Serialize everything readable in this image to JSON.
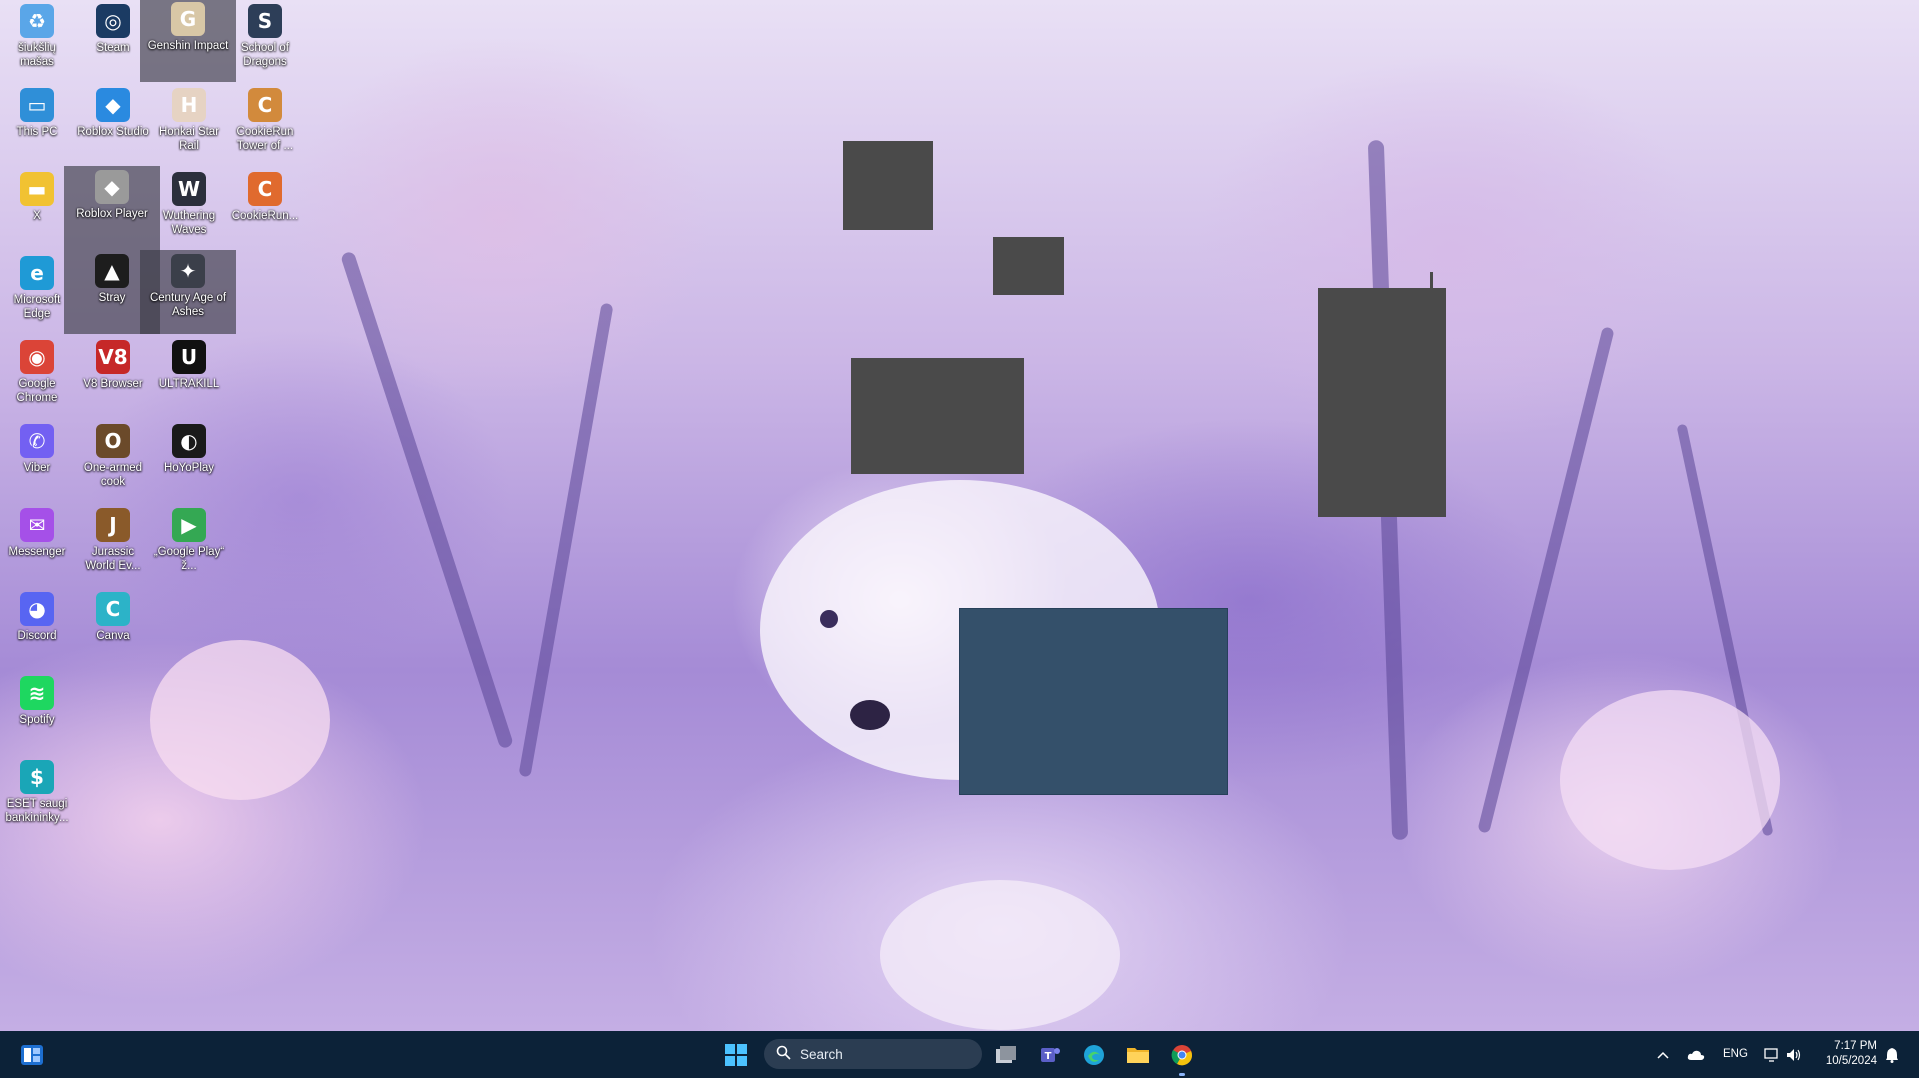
{
  "desktop": {
    "icons": [
      {
        "label": "šiukšlių mašas",
        "icon": "recycle-bin-icon",
        "glyph": "♻",
        "color": "#5aa6e8",
        "selected": false
      },
      {
        "label": "Steam",
        "icon": "steam-icon",
        "glyph": "◎",
        "color": "#1b3b63",
        "selected": false
      },
      {
        "label": "Genshin Impact",
        "icon": "genshin-impact-icon",
        "glyph": "G",
        "color": "#d8c7a6",
        "selected": true
      },
      {
        "label": "School of Dragons",
        "icon": "school-of-dragons-icon",
        "glyph": "S",
        "color": "#2d3e58",
        "selected": false
      },
      {
        "label": "This PC",
        "icon": "this-pc-icon",
        "glyph": "▭",
        "color": "#2f8fd8",
        "selected": false
      },
      {
        "label": "Roblox Studio",
        "icon": "roblox-studio-icon",
        "glyph": "◆",
        "color": "#2a8ae0",
        "selected": false
      },
      {
        "label": "Honkai Star Rail",
        "icon": "honkai-star-rail-icon",
        "glyph": "H",
        "color": "#e6d3c3",
        "selected": false
      },
      {
        "label": "CookieRun Tower of ...",
        "icon": "cookierun-tower-icon",
        "glyph": "C",
        "color": "#d28a3c",
        "selected": false
      },
      {
        "label": "X",
        "icon": "folder-icon",
        "glyph": "▬",
        "color": "#f1c232",
        "selected": false
      },
      {
        "label": "Roblox Player",
        "icon": "roblox-player-icon",
        "glyph": "◆",
        "color": "#9a9a9a",
        "selected": true
      },
      {
        "label": "Wuthering Waves",
        "icon": "wuthering-waves-icon",
        "glyph": "W",
        "color": "#2b2f3c",
        "selected": false
      },
      {
        "label": "CookieRun...",
        "icon": "cookierun-icon",
        "glyph": "C",
        "color": "#e06a2e",
        "selected": false
      },
      {
        "label": "Microsoft Edge",
        "icon": "edge-icon",
        "glyph": "e",
        "color": "#1f9ad6",
        "selected": false
      },
      {
        "label": "Stray",
        "icon": "stray-icon",
        "glyph": "▲",
        "color": "#1d1d1d",
        "selected": true
      },
      {
        "label": "Century Age of Ashes",
        "icon": "century-age-of-ashes-icon",
        "glyph": "✦",
        "color": "#3b3f4a",
        "selected": true
      },
      {
        "label": "Google Chrome",
        "icon": "chrome-icon",
        "glyph": "◉",
        "color": "#db4437",
        "selected": false
      },
      {
        "label": "V8 Browser",
        "icon": "v8-browser-icon",
        "glyph": "V8",
        "color": "#c62828",
        "selected": false
      },
      {
        "label": "ULTRAKILL",
        "icon": "ultrakill-icon",
        "glyph": "U",
        "color": "#111111",
        "selected": false
      },
      {
        "label": "Viber",
        "icon": "viber-icon",
        "glyph": "✆",
        "color": "#7360f2",
        "selected": false
      },
      {
        "label": "One-armed cook",
        "icon": "one-armed-cook-icon",
        "glyph": "O",
        "color": "#6b4a2a",
        "selected": false
      },
      {
        "label": "HoYoPlay",
        "icon": "hoyoplay-icon",
        "glyph": "◐",
        "color": "#1a1a1a",
        "selected": false
      },
      {
        "label": "Messenger",
        "icon": "messenger-icon",
        "glyph": "✉",
        "color": "#a550e8",
        "selected": false
      },
      {
        "label": "Jurassic World Ev...",
        "icon": "jurassic-world-icon",
        "glyph": "J",
        "color": "#8a5a2a",
        "selected": false
      },
      {
        "label": "„Google Play“ ž...",
        "icon": "google-play-games-icon",
        "glyph": "▶",
        "color": "#34a853",
        "selected": false
      },
      {
        "label": "Discord",
        "icon": "discord-icon",
        "glyph": "◕",
        "color": "#5865f2",
        "selected": false
      },
      {
        "label": "Canva",
        "icon": "canva-icon",
        "glyph": "C",
        "color": "#2cb3c8",
        "selected": false
      },
      {
        "label": "Spotify",
        "icon": "spotify-icon",
        "glyph": "≋",
        "color": "#1ed760",
        "selected": false
      },
      {
        "label": "ESET saugi bankininky...",
        "icon": "eset-icon",
        "glyph": "$",
        "color": "#1aa6b7",
        "selected": false
      }
    ]
  },
  "taskbar": {
    "search_placeholder": "Search",
    "apps": [
      {
        "name": "task-view-icon"
      },
      {
        "name": "teams-icon"
      },
      {
        "name": "edge-icon"
      },
      {
        "name": "file-explorer-icon"
      },
      {
        "name": "chrome-icon"
      }
    ],
    "language": "ENG",
    "time": "7:17 PM",
    "date": "10/5/2024"
  }
}
